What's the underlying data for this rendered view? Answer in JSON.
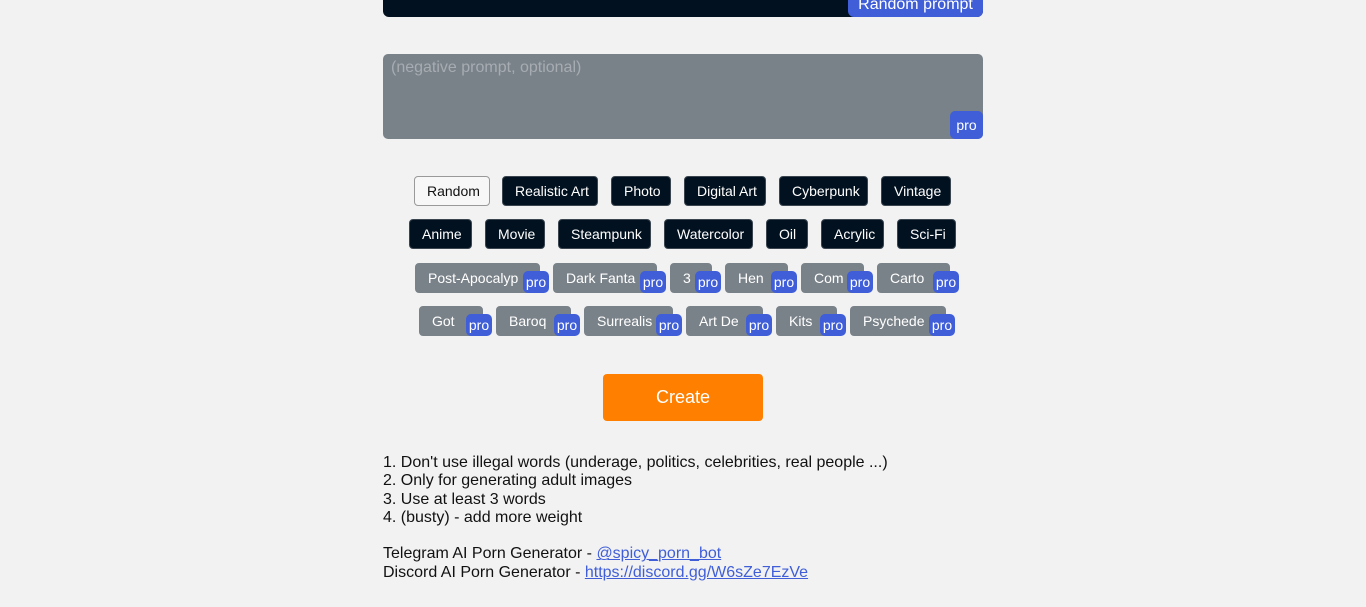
{
  "prompt": {
    "random_button": "Random prompt"
  },
  "negative_prompt": {
    "placeholder": "(negative prompt, optional)",
    "value": "",
    "badge": "pro"
  },
  "styles": [
    {
      "label": "Random",
      "state": "selected"
    },
    {
      "label": "Realistic Art",
      "state": "free"
    },
    {
      "label": "Photo",
      "state": "free"
    },
    {
      "label": "Digital Art",
      "state": "free"
    },
    {
      "label": "Cyberpunk",
      "state": "free"
    },
    {
      "label": "Vintage",
      "state": "free"
    },
    {
      "label": "Anime",
      "state": "free"
    },
    {
      "label": "Movie",
      "state": "free"
    },
    {
      "label": "Steampunk",
      "state": "free"
    },
    {
      "label": "Watercolor",
      "state": "free"
    },
    {
      "label": "Oil",
      "state": "free"
    },
    {
      "label": "Acrylic",
      "state": "free"
    },
    {
      "label": "Sci-Fi",
      "state": "free"
    },
    {
      "label": "Post-Apocalyp",
      "state": "pro"
    },
    {
      "label": "Dark Fanta",
      "state": "pro"
    },
    {
      "label": "3",
      "state": "pro"
    },
    {
      "label": "Hen",
      "state": "pro"
    },
    {
      "label": "Com",
      "state": "pro"
    },
    {
      "label": "Carto",
      "state": "pro"
    },
    {
      "label": "Got",
      "state": "pro"
    },
    {
      "label": "Baroq",
      "state": "pro"
    },
    {
      "label": "Surrealis",
      "state": "pro"
    },
    {
      "label": "Art De",
      "state": "pro"
    },
    {
      "label": "Kits",
      "state": "pro"
    },
    {
      "label": "Psychede",
      "state": "pro"
    }
  ],
  "pro_badge": "pro",
  "create_button": "Create",
  "rules": [
    "1. Don't use illegal words (underage, politics, celebrities, real people ...)",
    "2. Only for generating adult images",
    "3. Use at least 3 words",
    "4. (busty) - add more weight"
  ],
  "links": [
    {
      "prefix": "Telegram AI Porn Generator - ",
      "text": "@spicy_porn_bot"
    },
    {
      "prefix": "Discord AI Porn Generator - ",
      "text": "https://discord.gg/W6sZe7EzVe"
    }
  ],
  "colors": {
    "accent": "#3f5ed8",
    "create": "#ff8000",
    "dark": "#02111f",
    "locked": "#7a8289"
  }
}
